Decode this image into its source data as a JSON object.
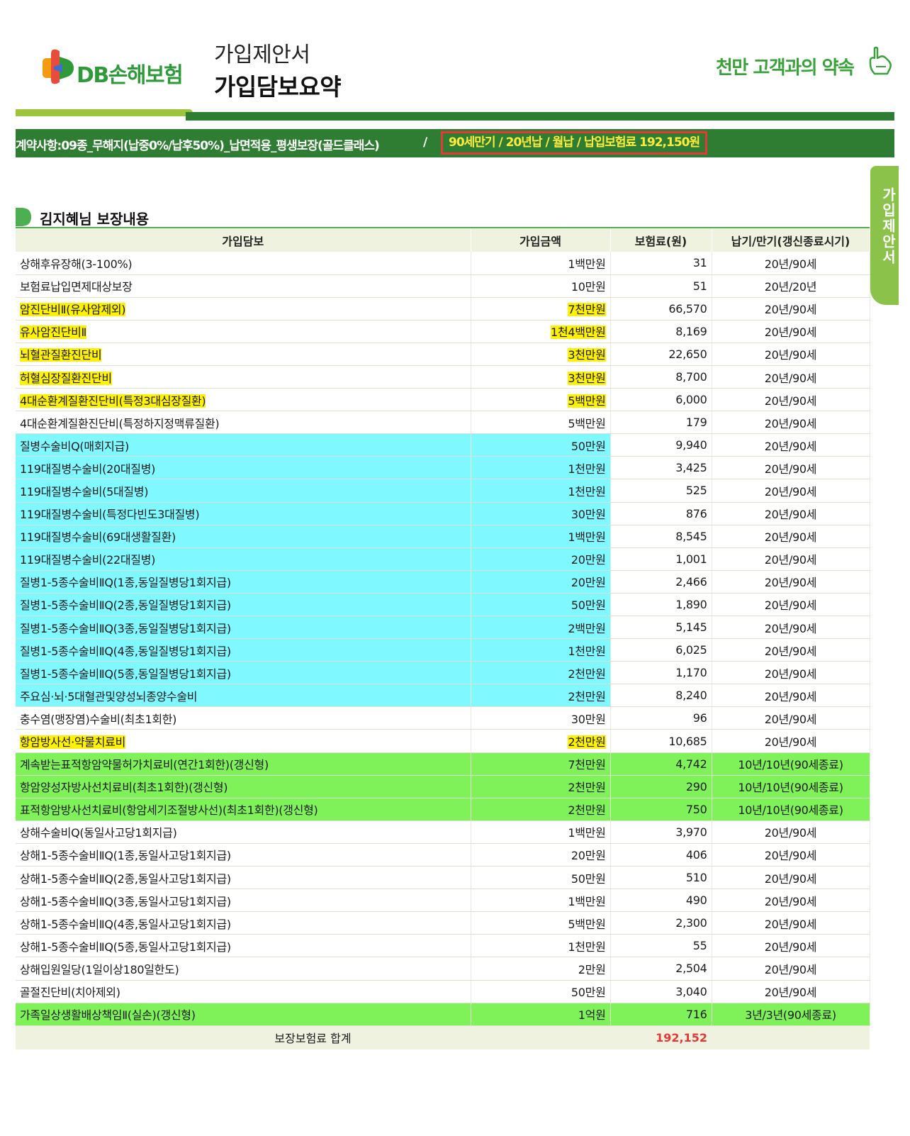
{
  "header": {
    "logo_text": "DB손해보험",
    "doc_subtitle": "가입제안서",
    "doc_title": "가입담보요약",
    "slogan": "천만 고객과의 약속"
  },
  "contract": {
    "summary": "계약사항:09종_무해지(납중0%/납후50%)_납면적용_평생보장(골드클래스)",
    "separator": "/",
    "highlight": "90세만기 / 20년납 / 월납 / 납입보험료 192,150원"
  },
  "side_tab": {
    "label": "가입제안서"
  },
  "section": {
    "title": "김지혜님 보장내용"
  },
  "table": {
    "headers": [
      "가입담보",
      "가입금액",
      "보험료(원)",
      "납기/만기(갱신종료시기)"
    ],
    "rows": [
      {
        "name": "상해후유장해(3-100%)",
        "amount": "1백만원",
        "premium": "31",
        "term": "20년/90세",
        "style": "none"
      },
      {
        "name": "보험료납입면제대상보장",
        "amount": "10만원",
        "premium": "51",
        "term": "20년/20년",
        "style": "none"
      },
      {
        "name": "암진단비Ⅱ(유사암제외)",
        "amount": "7천만원",
        "premium": "66,570",
        "term": "20년/90세",
        "style": "yellow"
      },
      {
        "name": "유사암진단비Ⅱ",
        "amount": "1천4백만원",
        "premium": "8,169",
        "term": "20년/90세",
        "style": "yellow"
      },
      {
        "name": "뇌혈관질환진단비",
        "amount": "3천만원",
        "premium": "22,650",
        "term": "20년/90세",
        "style": "yellow"
      },
      {
        "name": "허혈심장질환진단비",
        "amount": "3천만원",
        "premium": "8,700",
        "term": "20년/90세",
        "style": "yellow"
      },
      {
        "name": "4대순환계질환진단비(특정3대심장질환)",
        "amount": "5백만원",
        "premium": "6,000",
        "term": "20년/90세",
        "style": "yellow"
      },
      {
        "name": "4대순환계질환진단비(특정하지정맥류질환)",
        "amount": "5백만원",
        "premium": "179",
        "term": "20년/90세",
        "style": "none"
      },
      {
        "name": "질병수술비Q(매회지급)",
        "amount": "50만원",
        "premium": "9,940",
        "term": "20년/90세",
        "style": "cyan"
      },
      {
        "name": "119대질병수술비(20대질병)",
        "amount": "1천만원",
        "premium": "3,425",
        "term": "20년/90세",
        "style": "cyan"
      },
      {
        "name": "119대질병수술비(5대질병)",
        "amount": "1천만원",
        "premium": "525",
        "term": "20년/90세",
        "style": "cyan"
      },
      {
        "name": "119대질병수술비(특정다빈도3대질병)",
        "amount": "30만원",
        "premium": "876",
        "term": "20년/90세",
        "style": "cyan"
      },
      {
        "name": "119대질병수술비(69대생활질환)",
        "amount": "1백만원",
        "premium": "8,545",
        "term": "20년/90세",
        "style": "cyan"
      },
      {
        "name": "119대질병수술비(22대질병)",
        "amount": "20만원",
        "premium": "1,001",
        "term": "20년/90세",
        "style": "cyan"
      },
      {
        "name": "질병1-5종수술비ⅡQ(1종,동일질병당1회지급)",
        "amount": "20만원",
        "premium": "2,466",
        "term": "20년/90세",
        "style": "cyan"
      },
      {
        "name": "질병1-5종수술비ⅡQ(2종,동일질병당1회지급)",
        "amount": "50만원",
        "premium": "1,890",
        "term": "20년/90세",
        "style": "cyan"
      },
      {
        "name": "질병1-5종수술비ⅡQ(3종,동일질병당1회지급)",
        "amount": "2백만원",
        "premium": "5,145",
        "term": "20년/90세",
        "style": "cyan"
      },
      {
        "name": "질병1-5종수술비ⅡQ(4종,동일질병당1회지급)",
        "amount": "1천만원",
        "premium": "6,025",
        "term": "20년/90세",
        "style": "cyan"
      },
      {
        "name": "질병1-5종수술비ⅡQ(5종,동일질병당1회지급)",
        "amount": "2천만원",
        "premium": "1,170",
        "term": "20년/90세",
        "style": "cyan"
      },
      {
        "name": "주요심·뇌·5대혈관및양성뇌종양수술비",
        "amount": "2천만원",
        "premium": "8,240",
        "term": "20년/90세",
        "style": "cyan"
      },
      {
        "name": "충수염(맹장염)수술비(최초1회한)",
        "amount": "30만원",
        "premium": "96",
        "term": "20년/90세",
        "style": "none"
      },
      {
        "name": "항암방사선·약물치료비",
        "amount": "2천만원",
        "premium": "10,685",
        "term": "20년/90세",
        "style": "yellow"
      },
      {
        "name": "계속받는표적항암약물허가치료비(연간1회한)(갱신형)",
        "amount": "7천만원",
        "premium": "4,742",
        "term": "10년/10년(90세종료)",
        "style": "green"
      },
      {
        "name": "항암양성자방사선치료비(최초1회한)(갱신형)",
        "amount": "2천만원",
        "premium": "290",
        "term": "10년/10년(90세종료)",
        "style": "green"
      },
      {
        "name": "표적항암방사선치료비(항암세기조절방사선)(최초1회한)(갱신형)",
        "amount": "2천만원",
        "premium": "750",
        "term": "10년/10년(90세종료)",
        "style": "green"
      },
      {
        "name": "상해수술비Q(동일사고당1회지급)",
        "amount": "1백만원",
        "premium": "3,970",
        "term": "20년/90세",
        "style": "none"
      },
      {
        "name": "상해1-5종수술비ⅡQ(1종,동일사고당1회지급)",
        "amount": "20만원",
        "premium": "406",
        "term": "20년/90세",
        "style": "none"
      },
      {
        "name": "상해1-5종수술비ⅡQ(2종,동일사고당1회지급)",
        "amount": "50만원",
        "premium": "510",
        "term": "20년/90세",
        "style": "none"
      },
      {
        "name": "상해1-5종수술비ⅡQ(3종,동일사고당1회지급)",
        "amount": "1백만원",
        "premium": "490",
        "term": "20년/90세",
        "style": "none"
      },
      {
        "name": "상해1-5종수술비ⅡQ(4종,동일사고당1회지급)",
        "amount": "5백만원",
        "premium": "2,300",
        "term": "20년/90세",
        "style": "none"
      },
      {
        "name": "상해1-5종수술비ⅡQ(5종,동일사고당1회지급)",
        "amount": "1천만원",
        "premium": "55",
        "term": "20년/90세",
        "style": "none"
      },
      {
        "name": "상해입원일당(1일이상180일한도)",
        "amount": "2만원",
        "premium": "2,504",
        "term": "20년/90세",
        "style": "none"
      },
      {
        "name": "골절진단비(치아제외)",
        "amount": "50만원",
        "premium": "3,040",
        "term": "20년/90세",
        "style": "none"
      },
      {
        "name": "가족일상생활배상책임Ⅱ(실손)(갱신형)",
        "amount": "1억원",
        "premium": "716",
        "term": "3년/3년(90세종료)",
        "style": "green"
      }
    ],
    "total_label": "보장보험료 합계",
    "total_value": "192,152"
  },
  "colors": {
    "brand_green": "#2e7d32",
    "light_green": "#9bc53d",
    "highlight_yellow": "#fff200",
    "highlight_cyan": "#7ff8ff",
    "highlight_green": "#7ff25a",
    "total_red": "#e53935"
  }
}
